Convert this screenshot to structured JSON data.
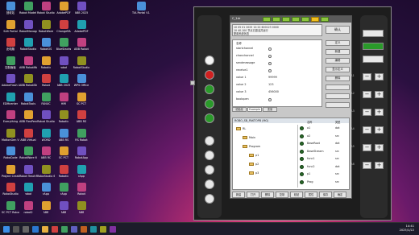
{
  "desktop": {
    "col1": [
      "回收站",
      "SAS Portal",
      "此电脑",
      "控制面板",
      "AdobeFlash Update M",
      "EDMcenter",
      "Everything",
      "MotionGen V1.2.0",
      "RoboCode",
      "Project Creator",
      "RoboStudio",
      "SC PCT RoboCode"
    ],
    "col2": [
      "Robot Model Robot",
      "RobotManage",
      "RobotStudio",
      "ABB RobotWare",
      "ABB RobotStudio",
      "RobotTools",
      "ABB FlexPendant",
      "ABB Virtual",
      "RobotWare 6",
      "Robot TeachPendant",
      "robot",
      "robot2"
    ],
    "col3": [
      "Robot Studio S7",
      "RobotWare",
      "RobotOS",
      "Robotic",
      "Robot",
      "FANUC",
      "Robot Studio",
      "WORD",
      "ABB RC",
      "RoboStudio 6.08",
      "rApp",
      "ABB"
    ],
    "col4": [
      "AdobePDF",
      "ChangeRA",
      "BlueStacks",
      "robot",
      "ABB 2025",
      "HMI",
      "Robotic",
      "ABB RS",
      "SC PCT",
      "Robotic",
      "rApp",
      "ABB"
    ],
    "col5": [
      "ABB 2025",
      "AdobePDF",
      "ABB Robot",
      "RobotStudio",
      "WPS Office",
      "SC PCT",
      "ABB RS",
      "RS Robot",
      "RobotApp",
      "rApp",
      "Robot",
      "ABB"
    ],
    "top_right": [
      "TIA Portal V14"
    ]
  },
  "pendant": {
    "title": "C_1dr",
    "msg_line1": "10 05 01 2025 12:22 600123 0000",
    "msg_line2": "10 40.100 节点已激活并运行",
    "msg_line3": "配置系统状态",
    "confirm_label": "确认",
    "var_header": "名称",
    "variables": [
      {
        "name": "startchannel",
        "value": ""
      },
      {
        "name": "chanchannel",
        "value": ""
      },
      {
        "name": "sendmessage",
        "value": ""
      },
      {
        "name": "receive1",
        "value": ""
      },
      {
        "name": "value 1",
        "value": "99999"
      },
      {
        "name": "value 2",
        "value": "123"
      },
      {
        "name": "value 3",
        "value": "456000"
      },
      {
        "name": "boolopen",
        "value": ""
      }
    ],
    "side_buttons": [
      "定义",
      "新建",
      "编辑",
      "显示定义",
      "删除",
      "",
      "",
      ""
    ],
    "tabs": [
      "初始化",
      "Example",
      "变量"
    ],
    "nav_header": "ROBO_SB_PAKTOPB (MG)",
    "tree": [
      {
        "label": "RL",
        "indent": 0
      },
      {
        "label": "Main",
        "indent": 1
      },
      {
        "label": "Program",
        "indent": 1
      },
      {
        "label": "p1",
        "indent": 2
      },
      {
        "label": "p2",
        "indent": 2
      },
      {
        "label": "p3",
        "indent": 2
      }
    ],
    "list_header_name": "名称",
    "list_header_type": "类型",
    "list": [
      {
        "name": "a1",
        "ext": "dat"
      },
      {
        "name": "a2",
        "ext": "src"
      },
      {
        "name": "BaseRoot",
        "ext": "dat"
      },
      {
        "name": "BaseStream",
        "ext": "src"
      },
      {
        "name": "func1",
        "ext": "src"
      },
      {
        "name": "func2",
        "ext": "dat"
      },
      {
        "name": "p1",
        "ext": "src"
      },
      {
        "name": "Prog",
        "ext": "src"
      }
    ],
    "bottom_buttons": [
      "新建",
      "打开",
      "删除",
      "复制",
      "粘贴",
      "属性",
      "保存",
      "确定"
    ],
    "right_labels": [
      "A1",
      "A2",
      "A3",
      "A4",
      "A5",
      "A6"
    ]
  },
  "taskbar": {
    "time": "14:41",
    "date": "2025/1/22"
  }
}
